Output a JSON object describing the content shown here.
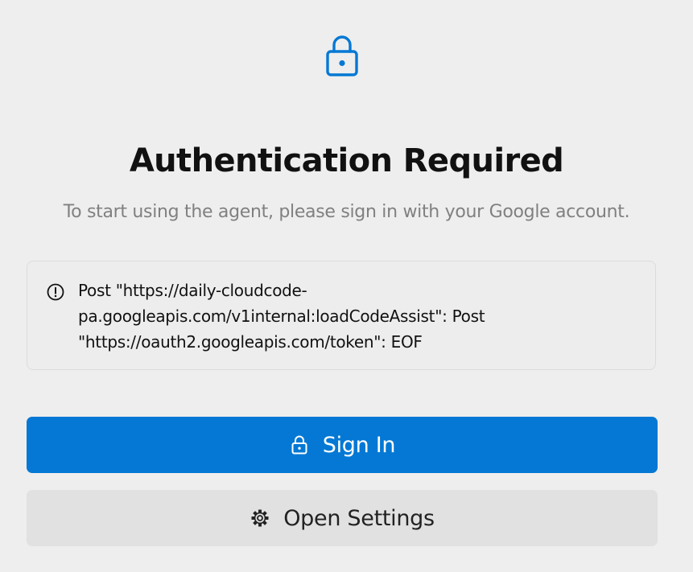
{
  "auth": {
    "lock_icon": "lock-icon",
    "title": "Authentication Required",
    "subtitle": "To start using the agent, please sign in with your Google account.",
    "error": {
      "icon": "alert-circle-icon",
      "message": "Post \"https://daily-cloudcode-\npa.googleapis.com/v1internal:loadCodeAssist\": Post\n\"https://oauth2.googleapis.com/token\": EOF"
    },
    "sign_in_button": {
      "icon": "lock-icon",
      "label": "Sign In"
    },
    "settings_button": {
      "icon": "gear-icon",
      "label": "Open Settings"
    }
  },
  "colors": {
    "accent": "#0478d4",
    "background": "#eeeeee",
    "subtitle_text": "#808080",
    "secondary_button": "#e1e1e1"
  }
}
